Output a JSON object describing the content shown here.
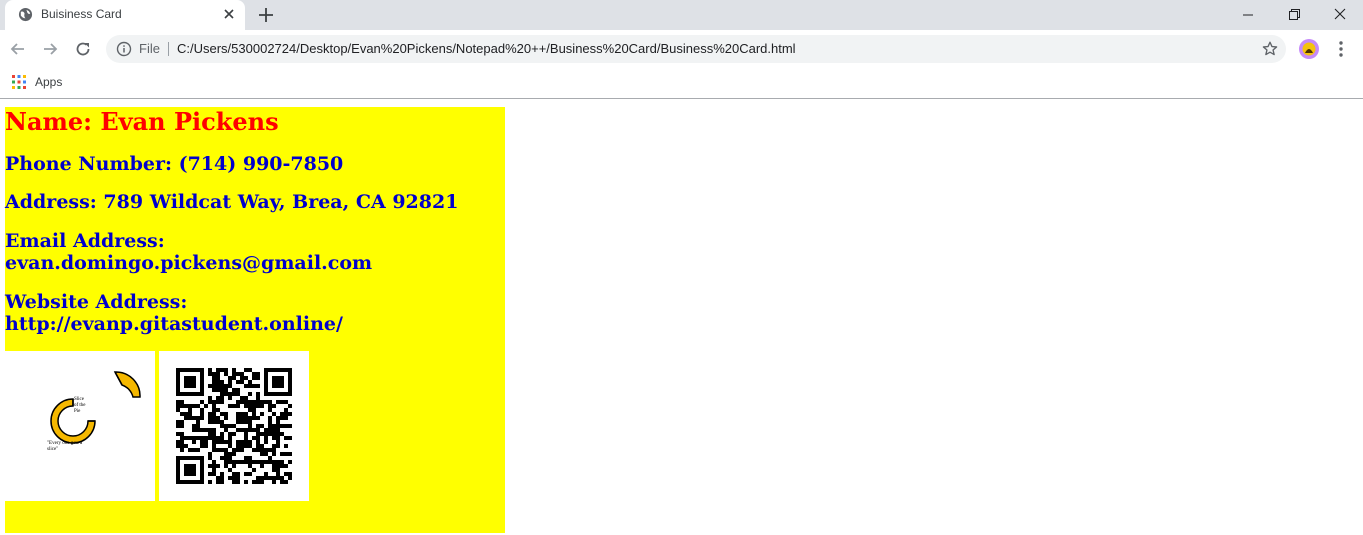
{
  "browser": {
    "tab_title": "Buisiness Card",
    "url_scheme": "File",
    "url": "C:/Users/530002724/Desktop/Evan%20Pickens/Notepad%20++/Business%20Card/Business%20Card.html",
    "bookmarks": {
      "apps_label": "Apps"
    }
  },
  "card": {
    "name": "Name: Evan Pickens",
    "phone": "Phone Number: (714) 990-7850",
    "address": "Address: 789 Wildcat Way, Brea, CA 92821",
    "email_label": "Email Address:",
    "email": "evan.domingo.pickens@gmail.com",
    "website_label": "Website Address:",
    "website": "http://evanp.gitastudent.online/",
    "logo": {
      "brand_lines": [
        "Slice",
        "of the",
        "Pie"
      ],
      "slogan_lines": [
        "\"Every one gets a",
        "slice\""
      ]
    }
  },
  "colors": {
    "card_background": "#ffff00",
    "name_text": "#ff0000",
    "details_text": "#0000cc"
  }
}
